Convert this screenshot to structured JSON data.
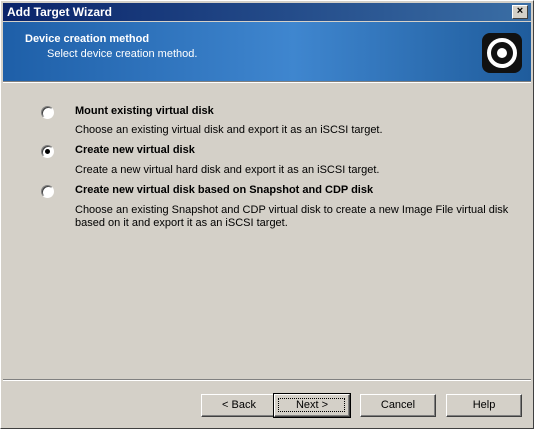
{
  "window": {
    "title": "Add Target Wizard",
    "close_glyph": "×"
  },
  "banner": {
    "title": "Device creation method",
    "subtitle": "Select device creation method.",
    "logo_icon": "target-ring-icon"
  },
  "options": [
    {
      "title": "Mount existing virtual disk",
      "description": "Choose an existing virtual disk and export it as an iSCSI target.",
      "selected": false
    },
    {
      "title": "Create new virtual disk",
      "description": "Create a new virtual hard disk and export it as an iSCSI target.",
      "selected": true
    },
    {
      "title": "Create new virtual disk based on Snapshot and CDP disk",
      "description_line1": "Choose an existing Snapshot and CDP virtual disk to create a new Image File virtual disk",
      "description_line2": "based on it and export it as an iSCSI target.",
      "selected": false
    }
  ],
  "buttons": {
    "back": "< Back",
    "next": "Next >",
    "cancel": "Cancel",
    "help": "Help"
  },
  "colors": {
    "banner_gradient": [
      "#1e5fa8",
      "#3f86cf",
      "#1f5c9c"
    ],
    "titlebar_gradient": [
      "#0a246a",
      "#3a6ea5"
    ],
    "face": "#d4d0c8"
  }
}
